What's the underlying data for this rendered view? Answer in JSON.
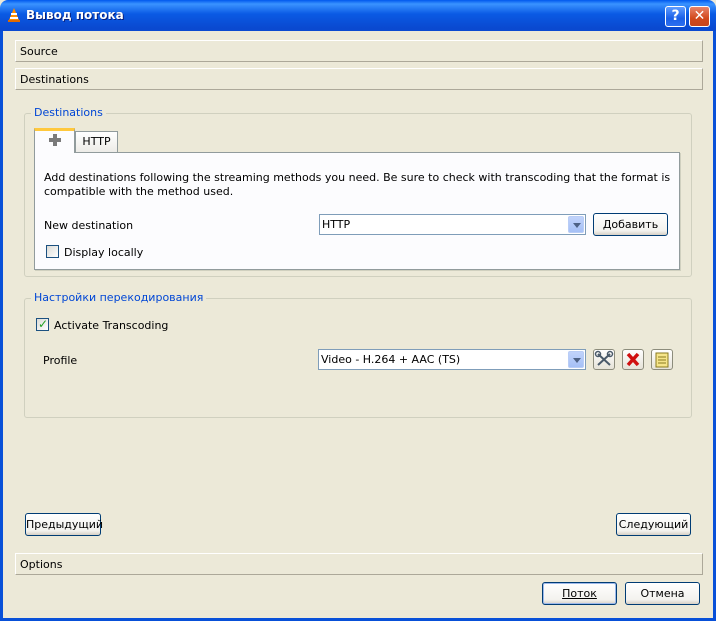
{
  "window": {
    "title": "Вывод потока",
    "help_glyph": "?",
    "close_glyph": "✕"
  },
  "sections": {
    "source": "Source",
    "destinations": "Destinations",
    "options": "Options"
  },
  "destinations_group": {
    "title": "Destinations",
    "tabs": [
      {
        "label": "",
        "icon": "plus-icon",
        "active": true
      },
      {
        "label": "HTTP",
        "active": false
      }
    ],
    "description": "Add destinations following the streaming methods you need. Be sure to check with transcoding that the format is compatible with the method used.",
    "new_destination_label": "New destination",
    "new_destination_value": "HTTP",
    "add_button": "Добавить",
    "display_locally_label": "Display locally",
    "display_locally_checked": false
  },
  "transcoding_group": {
    "title": "Настройки перекодирования",
    "activate_label": "Activate Transcoding",
    "activate_checked": true,
    "profile_label": "Profile",
    "profile_value": "Video - H.264 + AAC (TS)",
    "tool_icons": [
      "wrench-icon",
      "delete-icon",
      "new-profile-icon"
    ]
  },
  "nav": {
    "previous": "Предыдущий",
    "next": "Следующий"
  },
  "footer": {
    "stream": "Поток",
    "cancel": "Отмена"
  },
  "colors": {
    "accent": "#0046d5",
    "titlebar": "#0a49d0",
    "background": "#ece9d8"
  }
}
